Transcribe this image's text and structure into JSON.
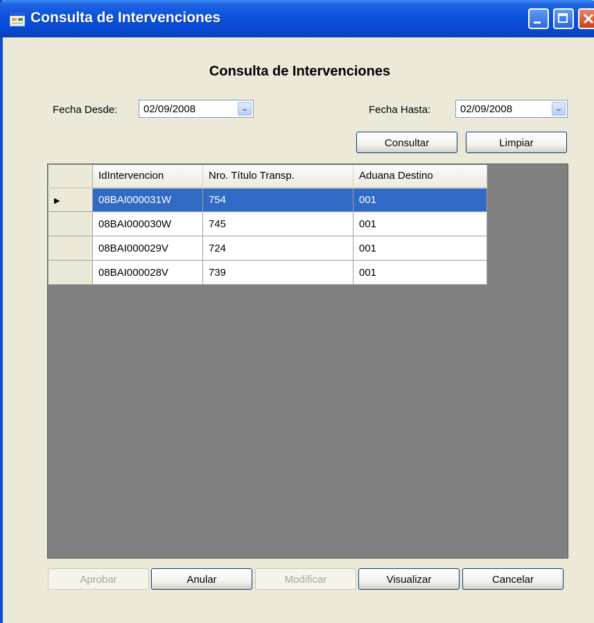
{
  "window": {
    "title": "Consulta de Intervenciones"
  },
  "form": {
    "heading": "Consulta de Intervenciones",
    "fecha_desde": {
      "label": "Fecha Desde:",
      "value": "02/09/2008"
    },
    "fecha_hasta": {
      "label": "Fecha Hasta:",
      "value": "02/09/2008"
    },
    "consultar": "Consultar",
    "limpiar": "Limpiar"
  },
  "grid": {
    "columns": [
      "IdIntervencion",
      "Nro. Título Transp.",
      "Aduana Destino"
    ],
    "rows": [
      [
        "08BAI000031W",
        "754",
        "001"
      ],
      [
        "08BAI000030W",
        "745",
        "001"
      ],
      [
        "08BAI000029V",
        "724",
        "001"
      ],
      [
        "08BAI000028V",
        "739",
        "001"
      ]
    ],
    "selected_row": 0
  },
  "buttons": {
    "aprobar": "Aprobar",
    "anular": "Anular",
    "modificar": "Modificar",
    "visualizar": "Visualizar",
    "cancelar": "Cancelar"
  },
  "colors": {
    "titlebar": "#0A52DC",
    "selection": "#316AC5",
    "grid_background": "#808080",
    "window_face": "#ECE9D8"
  }
}
